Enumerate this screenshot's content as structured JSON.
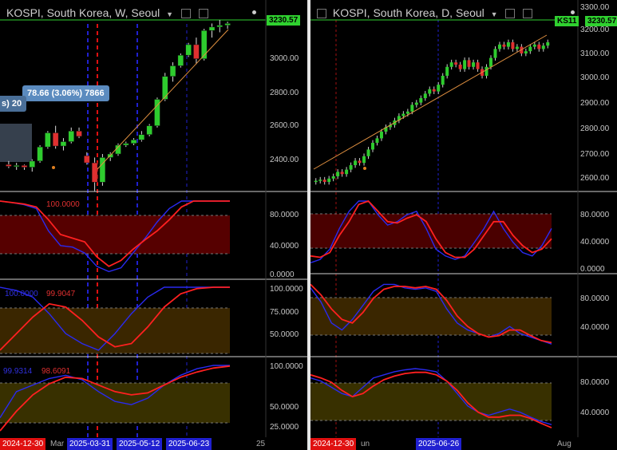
{
  "left_chart": {
    "title": "KOSPI, South Korea, W, Seoul",
    "last_price": "3230.57",
    "price_axis": [
      "3000.00",
      "2800.00",
      "2600.00",
      "2400.00"
    ],
    "tooltip_main": "78.66 (3.06%) 7866",
    "tooltip_prev": "s) 20",
    "indicator1": {
      "blue_value": "100.0000",
      "red_value": "100.0000",
      "axis": [
        "80.0000",
        "40.0000",
        "0.0000"
      ]
    },
    "indicator2": {
      "blue_value": "100.0000",
      "red_value": "99.9047",
      "axis": [
        "100.0000",
        "75.0000",
        "50.0000"
      ]
    },
    "indicator3": {
      "blue_value": "99.9314",
      "red_value": "98.6091",
      "axis": [
        "100.0000",
        "50.0000",
        "25.0000"
      ]
    },
    "date_labels": [
      "2024-12-30",
      "Mar",
      "2025-03-31",
      "2025-05-12",
      "2025-06-23",
      "25"
    ],
    "colors": {
      "up": "#2ecc2e",
      "down": "#e03030",
      "ind1_band": "#5a0000",
      "ind2_band": "#3d2a00",
      "ind3_band": "#3a3200"
    },
    "chart_data": {
      "type": "candlestick",
      "timeframe": "W",
      "ohlc": [
        [
          2430,
          2450,
          2410,
          2420
        ],
        [
          2420,
          2440,
          2400,
          2425
        ],
        [
          2425,
          2430,
          2400,
          2415
        ],
        [
          2415,
          2460,
          2390,
          2450
        ],
        [
          2450,
          2540,
          2440,
          2530
        ],
        [
          2530,
          2620,
          2520,
          2610
        ],
        [
          2610,
          2650,
          2520,
          2535
        ],
        [
          2535,
          2580,
          2510,
          2560
        ],
        [
          2560,
          2640,
          2550,
          2620
        ],
        [
          2620,
          2640,
          2580,
          2590
        ],
        [
          2480,
          2500,
          2430,
          2440
        ],
        [
          2440,
          2470,
          2280,
          2330
        ],
        [
          2330,
          2490,
          2310,
          2470
        ],
        [
          2470,
          2500,
          2450,
          2490
        ],
        [
          2490,
          2550,
          2480,
          2540
        ],
        [
          2540,
          2560,
          2530,
          2550
        ],
        [
          2550,
          2580,
          2540,
          2570
        ],
        [
          2570,
          2620,
          2560,
          2600
        ],
        [
          2600,
          2660,
          2590,
          2650
        ],
        [
          2650,
          2810,
          2640,
          2800
        ],
        [
          2800,
          2950,
          2790,
          2930
        ],
        [
          2930,
          3010,
          2900,
          2990
        ],
        [
          2990,
          3060,
          2980,
          3050
        ],
        [
          3050,
          3120,
          3040,
          3110
        ],
        [
          3110,
          3150,
          3000,
          3030
        ],
        [
          3030,
          3200,
          3020,
          3190
        ],
        [
          3190,
          3230,
          3150,
          3210
        ],
        [
          3210,
          3250,
          3180,
          3220
        ],
        [
          3220,
          3240,
          3200,
          3230
        ]
      ],
      "ylim": [
        2300,
        3250
      ]
    }
  },
  "right_chart": {
    "title": "KOSPI, South Korea, D, Seoul",
    "symbol_badge": "KS11",
    "last_price": "3230.57",
    "price_axis": [
      "3300.00",
      "3200.00",
      "3100.00",
      "3000.00",
      "2900.00",
      "2800.00",
      "2700.00",
      "2600.00"
    ],
    "indicator1": {
      "axis": [
        "80.0000",
        "40.0000",
        "0.0000"
      ]
    },
    "indicator2": {
      "axis": [
        "80.0000",
        "40.0000"
      ]
    },
    "indicator3": {
      "axis": [
        "80.0000",
        "40.0000"
      ]
    },
    "date_labels": [
      "2024-12-30",
      "un",
      "2025-06-26",
      "Aug"
    ],
    "chart_data": {
      "type": "candlestick",
      "timeframe": "D",
      "closes": [
        2610,
        2615,
        2605,
        2620,
        2630,
        2650,
        2640,
        2660,
        2680,
        2700,
        2690,
        2720,
        2750,
        2780,
        2800,
        2830,
        2850,
        2860,
        2880,
        2900,
        2910,
        2920,
        2950,
        2960,
        2980,
        3000,
        3020,
        3010,
        3040,
        3080,
        3120,
        3140,
        3130,
        3110,
        3150,
        3120,
        3140,
        3110,
        3080,
        3120,
        3160,
        3200,
        3220,
        3210,
        3230,
        3200,
        3210,
        3180,
        3190,
        3210,
        3220,
        3200,
        3215,
        3230
      ],
      "ylim": [
        2580,
        3330
      ]
    }
  }
}
